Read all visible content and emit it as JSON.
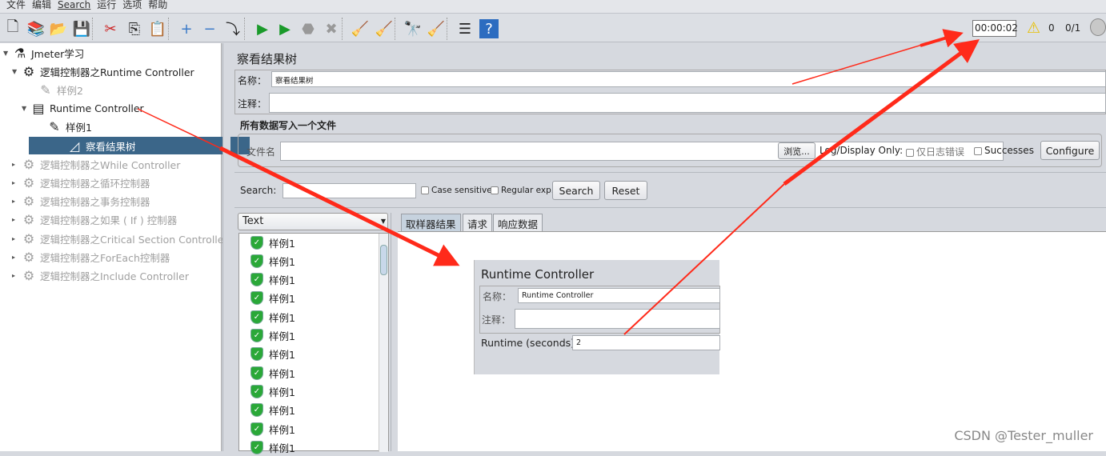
{
  "menu": [
    "文件",
    "编辑",
    "Search",
    "运行",
    "选项",
    "帮助"
  ],
  "toolbar": {
    "timer": "00:00:02",
    "warnings": "0",
    "threads": "0/1",
    "icons": [
      "new-icon",
      "templates-icon",
      "open-icon",
      "save-icon",
      "cut-icon",
      "copy-icon",
      "paste-icon",
      "expand-icon",
      "collapse-icon",
      "toggle-icon",
      "start-icon",
      "start-no-pause-icon",
      "stop-icon",
      "shutdown-icon",
      "clear-icon",
      "clear-all-icon",
      "search-icon",
      "reset-search-icon",
      "function-helper-icon",
      "help-icon"
    ]
  },
  "tree": {
    "items": [
      {
        "label": "Jmeter学习",
        "state": "normal"
      },
      {
        "label": "逻辑控制器之Runtime Controller",
        "state": "normal"
      },
      {
        "label": "样例2",
        "state": "dim"
      },
      {
        "label": "Runtime Controller",
        "state": "normal"
      },
      {
        "label": "样例1",
        "state": "normal"
      },
      {
        "label": "察看结果树",
        "state": "selected"
      },
      {
        "label": "逻辑控制器之While Controller",
        "state": "dim"
      },
      {
        "label": "逻辑控制器之循环控制器",
        "state": "dim"
      },
      {
        "label": "逻辑控制器之事务控制器",
        "state": "dim"
      },
      {
        "label": "逻辑控制器之如果 ( If ) 控制器",
        "state": "dim"
      },
      {
        "label": "逻辑控制器之Critical Section Controller",
        "state": "dim"
      },
      {
        "label": "逻辑控制器之ForEach控制器",
        "state": "dim"
      },
      {
        "label": "逻辑控制器之Include Controller",
        "state": "dim"
      }
    ]
  },
  "main": {
    "title": "察看结果树",
    "name_label": "名称：",
    "name_value": "察看结果树",
    "comment_label": "注释：",
    "file_section": "所有数据写入一个文件",
    "file_label": "文件名",
    "browse": "浏览...",
    "log_only": "Log/Display Only:",
    "errors": "仅日志错误",
    "successes": "Successes",
    "configure": "Configure",
    "search_label": "Search:",
    "case_sensitive": "Case sensitive",
    "regex": "Regular exp.",
    "search_btn": "Search",
    "reset_btn": "Reset",
    "renderer": "Text",
    "tabs": [
      "取样器结果",
      "请求",
      "响应数据"
    ],
    "results": [
      "样例1",
      "样例1",
      "样例1",
      "样例1",
      "样例1",
      "样例1",
      "样例1",
      "样例1",
      "样例1",
      "样例1",
      "样例1",
      "样例1"
    ]
  },
  "inset": {
    "title": "Runtime Controller",
    "name_label": "名称：",
    "name_value": "Runtime Controller",
    "comment_label": "注释：",
    "runtime_label": "Runtime (seconds)",
    "runtime_value": "2"
  },
  "colors": {
    "selection": "#3b6689",
    "annotation_arrow": "#ff2a1a",
    "success": "#2aa838"
  },
  "watermark": "CSDN @Tester_muller"
}
